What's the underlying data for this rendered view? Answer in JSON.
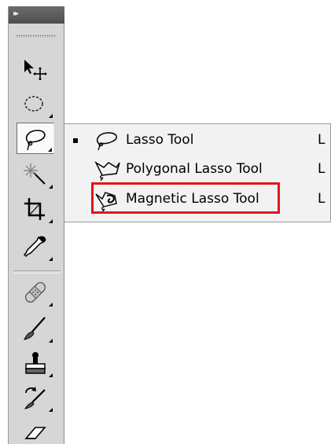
{
  "toolbar": {
    "collapse_glyph": "▸▸",
    "tools": [
      {
        "name": "move-tool",
        "icon": "move-icon"
      },
      {
        "name": "marquee-tool",
        "icon": "elliptical-marquee-icon"
      },
      {
        "name": "lasso-tool",
        "icon": "lasso-icon",
        "active": true
      },
      {
        "name": "magic-wand-tool",
        "icon": "magic-wand-icon"
      },
      {
        "name": "crop-tool",
        "icon": "crop-icon"
      },
      {
        "name": "eyedropper-tool",
        "icon": "eyedropper-icon"
      },
      {
        "name": "healing-brush-tool",
        "icon": "bandage-icon"
      },
      {
        "name": "brush-tool",
        "icon": "brush-icon"
      },
      {
        "name": "clone-stamp-tool",
        "icon": "stamp-icon"
      },
      {
        "name": "history-brush-tool",
        "icon": "history-brush-icon"
      },
      {
        "name": "eraser-tool",
        "icon": "eraser-icon"
      }
    ]
  },
  "flyout": {
    "items": [
      {
        "label": "Lasso Tool",
        "shortcut": "L",
        "selected": true,
        "icon": "lasso-icon"
      },
      {
        "label": "Polygonal Lasso Tool",
        "shortcut": "L",
        "selected": false,
        "icon": "polygonal-lasso-icon"
      },
      {
        "label": "Magnetic Lasso Tool",
        "shortcut": "L",
        "selected": false,
        "icon": "magnetic-lasso-icon",
        "highlighted": true
      }
    ]
  },
  "colors": {
    "highlight": "#e3141b",
    "toolbar_bg": "#d6d6d6",
    "menu_bg": "#f2f2f2"
  }
}
